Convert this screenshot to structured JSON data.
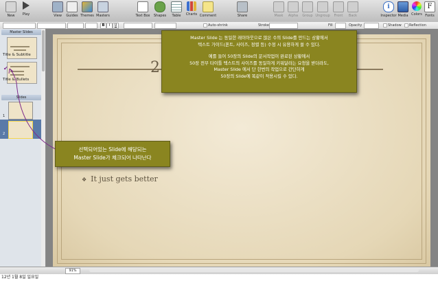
{
  "toolbar": {
    "left": [
      "New",
      "Play"
    ],
    "middle": [
      "View",
      "Guides",
      "Themes",
      "Masters"
    ],
    "insert": [
      "Text Box",
      "Shapes",
      "Table",
      "Charts",
      "Comment"
    ],
    "share": "Share",
    "arrange": [
      "Mask",
      "Alpha",
      "Group",
      "Ungroup",
      "Front",
      "Back"
    ],
    "right": [
      "Inspector",
      "Media",
      "Colors",
      "Fonts"
    ]
  },
  "formatbar": {
    "style_buttons": [
      "B",
      "I",
      "U"
    ],
    "autoshrink": "Auto-shrink",
    "stroke": "Stroke",
    "fill": "Fill",
    "opacity": "Opacity",
    "shadow": "Shadow",
    "reflection": "Reflection"
  },
  "navigator": {
    "master_header": "Master Slides",
    "masters": [
      "Title & Subtitle",
      "Title & Bullets"
    ],
    "slides_header": "Slides",
    "slide_numbers": [
      "1",
      "2"
    ]
  },
  "slide": {
    "number": "2",
    "bullet_symbol": "❖",
    "bullet_text": "It just gets better"
  },
  "callouts": {
    "top": [
      "Master Slide 는 동일한 레이아웃으로 많은 수의 Slide를 만드는 상황에서",
      "텍스트 가이드(폰트, 사이즈, 정렬 등) 수정 시 유용하게 쓸 수 있다.",
      "",
      "예를 들어 50장의 Slide의 문서작업이 완료된 상황에서",
      "50장 전부 타이틀 텍스트의 사이즈를 동일하게 키워달라는 요청을 받더라도,",
      "Master Slide 에서 단 한번의 작업으로 간단하게",
      "50장의 Slide에 똑같이 적용시킬 수 있다."
    ],
    "left": [
      "선택되어있는 Slide에 해당되는",
      "Master Slide가 체크되어 나타난다"
    ]
  },
  "statusbar": {
    "zoom": "91%"
  },
  "caption": "12년 1월 8일 일요일"
}
